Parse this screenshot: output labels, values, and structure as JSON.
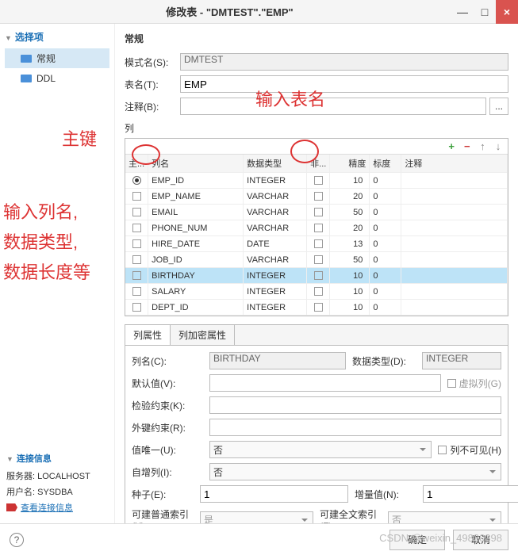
{
  "titlebar": {
    "title": "修改表 - \"DMTEST\".\"EMP\""
  },
  "sidebar": {
    "title": "选择项",
    "items": [
      {
        "label": "常规",
        "active": true
      },
      {
        "label": "DDL",
        "active": false
      }
    ]
  },
  "section_header": "常规",
  "form": {
    "schema_label": "模式名(S):",
    "schema_value": "DMTEST",
    "table_label": "表名(T):",
    "table_value": "EMP",
    "comment_label": "注释(B):",
    "comment_value": "",
    "columns_label": "列"
  },
  "grid": {
    "headers": {
      "pk": "主...",
      "name": "列名",
      "type": "数据类型",
      "nn": "非...",
      "prec": "精度",
      "scale": "标度",
      "comment": "注释"
    },
    "rows": [
      {
        "pk": true,
        "name": "EMP_ID",
        "type": "INTEGER",
        "nn": false,
        "prec": 10,
        "scale": 0
      },
      {
        "pk": false,
        "name": "EMP_NAME",
        "type": "VARCHAR",
        "nn": false,
        "prec": 20,
        "scale": 0
      },
      {
        "pk": false,
        "name": "EMAIL",
        "type": "VARCHAR",
        "nn": false,
        "prec": 50,
        "scale": 0
      },
      {
        "pk": false,
        "name": "PHONE_NUM",
        "type": "VARCHAR",
        "nn": false,
        "prec": 20,
        "scale": 0
      },
      {
        "pk": false,
        "name": "HIRE_DATE",
        "type": "DATE",
        "nn": false,
        "prec": 13,
        "scale": 0
      },
      {
        "pk": false,
        "name": "JOB_ID",
        "type": "VARCHAR",
        "nn": false,
        "prec": 50,
        "scale": 0
      },
      {
        "pk": false,
        "name": "BIRTHDAY",
        "type": "INTEGER",
        "nn": false,
        "prec": 10,
        "scale": 0,
        "selected": true
      },
      {
        "pk": false,
        "name": "SALARY",
        "type": "INTEGER",
        "nn": false,
        "prec": 10,
        "scale": 0
      },
      {
        "pk": false,
        "name": "DEPT_ID",
        "type": "INTEGER",
        "nn": false,
        "prec": 10,
        "scale": 0
      }
    ]
  },
  "tabs": {
    "items": [
      "列属性",
      "列加密属性"
    ],
    "col_name_label": "列名(C):",
    "col_name_value": "BIRTHDAY",
    "data_type_label": "数据类型(D):",
    "data_type_value": "INTEGER",
    "default_label": "默认值(V):",
    "virtual_label": "虚拟列(G)",
    "check_label": "检验约束(K):",
    "fk_label": "外键约束(R):",
    "unique_label": "值唯一(U):",
    "unique_value": "否",
    "hidden_label": "列不可见(H)",
    "autoinc_label": "自增列(I):",
    "autoinc_value": "否",
    "seed_label": "种子(E):",
    "seed_value": "1",
    "incr_label": "增量值(N):",
    "incr_value": "1",
    "idx_label": "可建普通索引(X):",
    "idx_value": "是",
    "fulltext_label": "可建全文索引(F):",
    "fulltext_value": "否"
  },
  "conn": {
    "title": "连接信息",
    "server_label": "服务器:",
    "server_value": "LOCALHOST",
    "user_label": "用户名:",
    "user_value": "SYSDBA",
    "link": "查看连接信息"
  },
  "footer": {
    "ok": "确定",
    "cancel": "取消"
  },
  "annotations": {
    "pk": "主键",
    "table_name": "输入表名",
    "left1": "输入列名,",
    "left2": "数据类型,",
    "left3": "数据长度等"
  },
  "watermark": "CSDN @weixin_49830398"
}
